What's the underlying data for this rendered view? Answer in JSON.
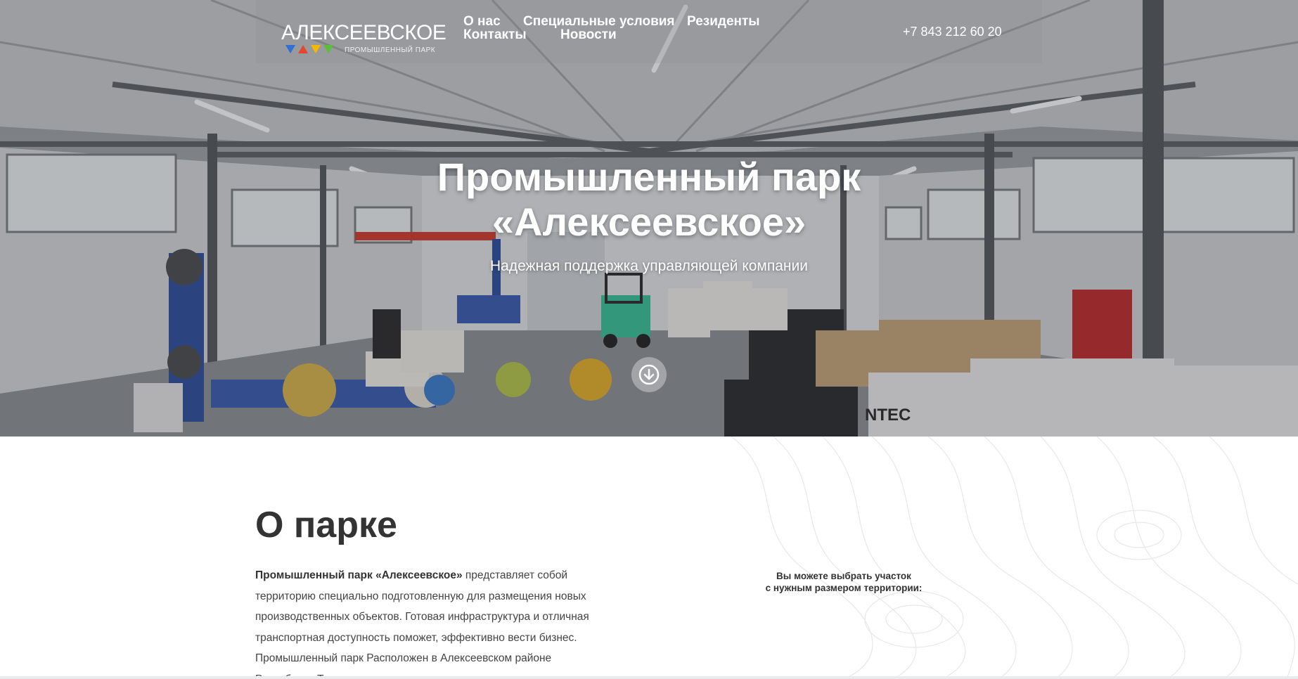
{
  "header": {
    "logo": {
      "word": "АЛЕКСЕЕВСКОЕ",
      "subtitle": "ПРОМЫШЛЕННЫЙ ПАРК",
      "colors": [
        "#2f6fd6",
        "#e6452e",
        "#f5b800",
        "#5bbf3a"
      ]
    },
    "nav": [
      {
        "label": "О нас"
      },
      {
        "label": "Специальные условия"
      },
      {
        "label": "Резиденты"
      },
      {
        "label": "Контакты"
      },
      {
        "label": "Новости"
      }
    ],
    "phone": "+7 843 212 60 20"
  },
  "hero": {
    "title_line1": "Промышленный парк",
    "title_line2": "«Алексеевское»",
    "subtitle": "Надежная поддержка управляющей компании",
    "scroll_icon": "arrow-down-circle-icon"
  },
  "about": {
    "title": "О парке",
    "text_bold": "Промышленный парк «Алексеевское»",
    "text_rest": " представляет собой территорию специально подготовленную для размещения новых производственных объектов. Готовая инфраструктура и отличная транспортная доступность поможет, эффективно вести бизнес. Промышленный парк Расположен в Алексеевском районе Республики Татарстан, и занимает",
    "pick_line1": "Вы можете выбрать участок",
    "pick_line2": "с нужным размером территории:"
  }
}
